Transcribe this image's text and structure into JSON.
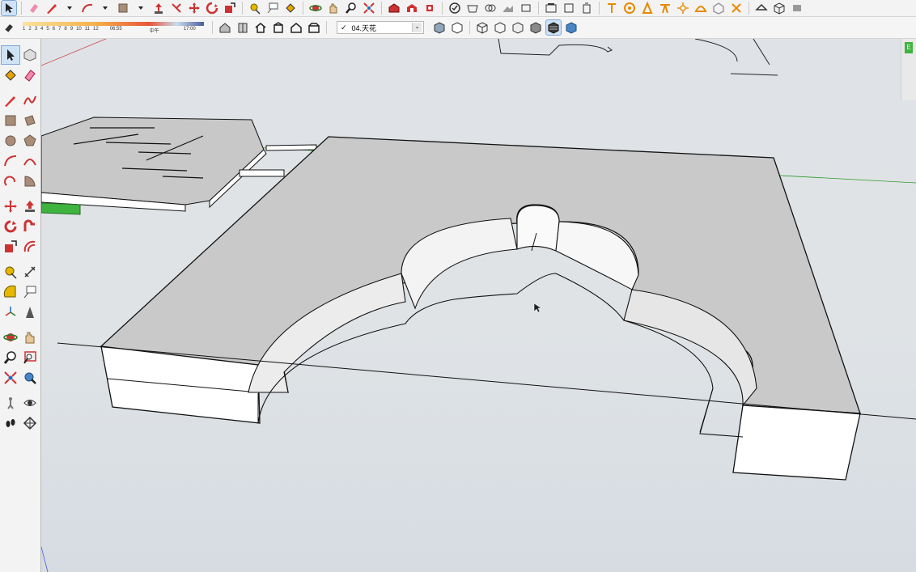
{
  "toolbar": {
    "shadow_scale": {
      "months": [
        "1",
        "2",
        "3",
        "4",
        "5",
        "6",
        "7",
        "8",
        "9",
        "10",
        "11",
        "12"
      ],
      "time_start": "06:55",
      "time_mid": "中午",
      "time_end": "17:00"
    },
    "scene_selector": {
      "check": "✓",
      "value": "04.天花",
      "chevron": "⌄"
    }
  },
  "right_tab": {
    "label": "E"
  },
  "colors": {
    "viewport_bg": "#dfe3e7",
    "face_top": "#c9c9c9",
    "face_side": "#ffffff",
    "edge": "#000000",
    "green_axis": "#2e9a2e",
    "red_axis": "#d24545",
    "selection_blue": "#cfe3f7"
  }
}
